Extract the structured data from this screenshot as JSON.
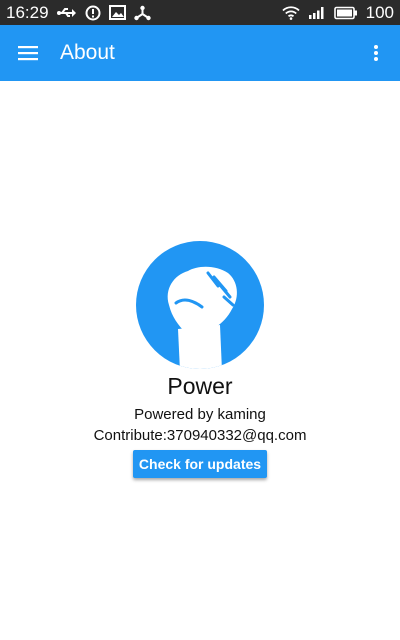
{
  "status_bar": {
    "time": "16:29",
    "battery_level": "100",
    "left_icons": [
      "usb-icon",
      "alert-icon",
      "image-icon",
      "share-icon"
    ],
    "right_icons": [
      "wifi-icon",
      "signal-icon",
      "battery-icon"
    ]
  },
  "app_bar": {
    "title": "About",
    "menu_icon": "hamburger-menu-icon",
    "overflow_icon": "more-vertical-icon"
  },
  "about": {
    "app_name": "Power",
    "powered_by": "Powered by kaming",
    "contact": "Contribute:370940332@qq.com",
    "check_updates_label": "Check for updates",
    "logo_icon": "fist-logo-icon"
  },
  "colors": {
    "primary": "#2196F3",
    "status_bar": "#2b2b2b"
  }
}
